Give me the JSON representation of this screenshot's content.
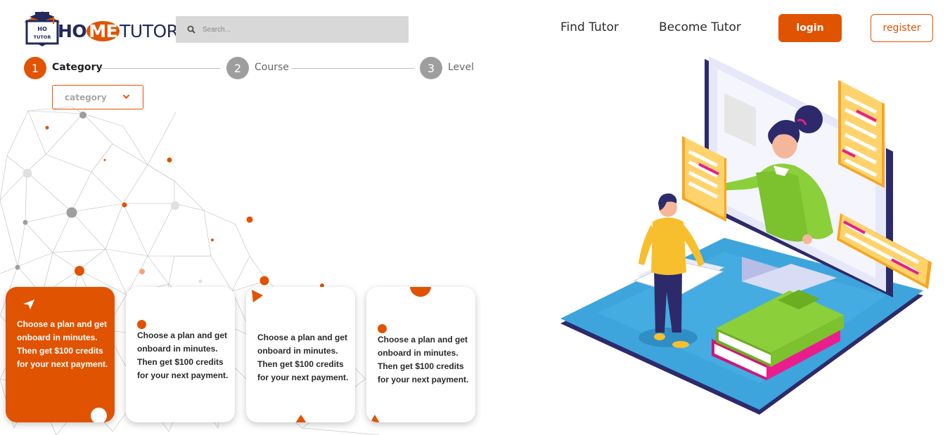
{
  "brand": {
    "logo_badge_top": "HO",
    "logo_badge_bottom": "TUTOR",
    "logo_ho": "HO",
    "logo_me": "ME",
    "logo_tutor": "TUTOR"
  },
  "search": {
    "placeholder": "Search..."
  },
  "nav": {
    "find_tutor": "Find Tutor",
    "become_tutor": "Become Tutor",
    "login": "login",
    "register": "register"
  },
  "stepper": {
    "steps": [
      {
        "number": "1",
        "label": "Category",
        "state": "active"
      },
      {
        "number": "2",
        "label": "Course",
        "state": "inactive"
      },
      {
        "number": "3",
        "label": "Level",
        "state": "inactive"
      }
    ]
  },
  "category_select": {
    "value": "category"
  },
  "cards": [
    {
      "line1": "Choose a plan and get",
      "line2": "onboard in minutes.",
      "line3": "Then get $100 credits",
      "line4": "for your next payment.",
      "active": true
    },
    {
      "line1": "Choose a plan and get",
      "line2": "onboard in minutes.",
      "line3": "Then get $100 credits",
      "line4": "for your next payment.",
      "active": false
    },
    {
      "line1": "Choose a plan and get",
      "line2": "onboard in minutes.",
      "line3": "Then get $100 credits",
      "line4": "for your next payment.",
      "active": false
    },
    {
      "line1": "Choose a plan and get",
      "line2": "onboard in minutes.",
      "line3": "Then get $100 credits",
      "line4": "for your next payment.",
      "active": false
    }
  ],
  "colors": {
    "accent": "#e05300",
    "step_inactive": "#9e9e9e",
    "brand_navy": "#222a5b",
    "search_bg": "#d8d8d8"
  },
  "icons": {
    "logo": "graduation-house-logo-icon",
    "search": "search-icon",
    "dropdown": "chevron-down-icon",
    "hero": "online-tutoring-illustration"
  }
}
